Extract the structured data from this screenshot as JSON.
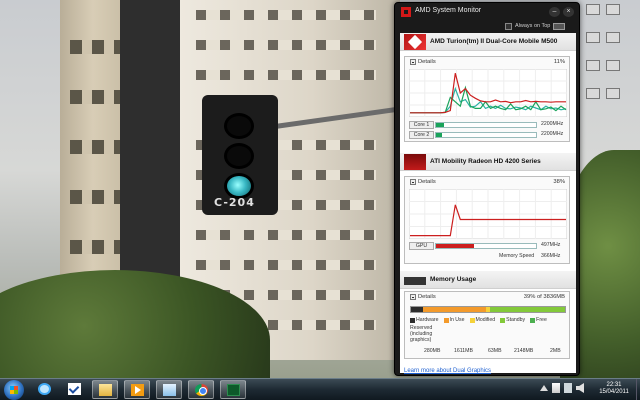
{
  "window": {
    "title": "AMD System Monitor",
    "always_on_top_label": "Always on Top",
    "minimize_glyph": "–",
    "close_glyph": "×"
  },
  "cpu": {
    "name": "AMD Turion(tm) II Dual-Core Mobile M500",
    "details_label": "Details",
    "usage_percent": "11%",
    "cores": [
      {
        "label": "Core 1",
        "load": 0.08,
        "value": "2200MHz"
      },
      {
        "label": "Core 2",
        "load": 0.06,
        "value": "2200MHz"
      }
    ],
    "history": {
      "red": [
        0.05,
        0.05,
        0.05,
        0.05,
        0.05,
        0.05,
        0.05,
        0.06,
        0.1,
        0.95,
        0.5,
        0.6,
        0.45,
        0.38,
        0.32,
        0.3,
        0.3,
        0.34,
        0.3,
        0.31,
        0.28,
        0.3,
        0.3,
        0.33,
        0.3,
        0.31,
        0.3,
        0.3,
        0.29,
        0.3,
        0.3,
        0.3
      ],
      "green": [
        0.05,
        0.05,
        0.05,
        0.05,
        0.05,
        0.05,
        0.05,
        0.06,
        0.4,
        0.3,
        0.2,
        0.62,
        0.2,
        0.15,
        0.15,
        0.3,
        0.15,
        0.2,
        0.15,
        0.12,
        0.25,
        0.12,
        0.14,
        0.2,
        0.12,
        0.3,
        0.12,
        0.14,
        0.18,
        0.1,
        0.2,
        0.12
      ],
      "teal": [
        0.05,
        0.05,
        0.05,
        0.05,
        0.05,
        0.05,
        0.05,
        0.06,
        0.2,
        0.6,
        0.3,
        0.35,
        0.18,
        0.2,
        0.3,
        0.15,
        0.2,
        0.15,
        0.22,
        0.15,
        0.14,
        0.18,
        0.16,
        0.12,
        0.2,
        0.16,
        0.12,
        0.2,
        0.14,
        0.16,
        0.12,
        0.14
      ]
    }
  },
  "gpu": {
    "name": "ATI Mobility Radeon HD 4200 Series",
    "details_label": "Details",
    "usage_percent": "38%",
    "bar_label": "GPU",
    "load": 0.38,
    "clock": "497MHz",
    "memory_speed_label": "Memory Speed",
    "memory_speed": "366MHz",
    "history": [
      0.03,
      0.03,
      0.03,
      0.03,
      0.03,
      0.03,
      0.03,
      0.03,
      0.03,
      0.7,
      0.38,
      0.38,
      0.38,
      0.38,
      0.38,
      0.38,
      0.38,
      0.38,
      0.38,
      0.38,
      0.38,
      0.38,
      0.38,
      0.38,
      0.38,
      0.38,
      0.38,
      0.38,
      0.38,
      0.38,
      0.38,
      0.38
    ]
  },
  "memory": {
    "title": "Memory Usage",
    "details_label": "Details",
    "usage_text": "39% of 3836MB",
    "segments": [
      {
        "name": "Hardware",
        "fraction": 0.08,
        "color": "#2d2d2d"
      },
      {
        "name": "In Use",
        "fraction": 0.42,
        "color": "#f39a2b"
      },
      {
        "name": "Modified",
        "fraction": 0.02,
        "color": "#f5d23a"
      },
      {
        "name": "Standby",
        "fraction": 0.5,
        "color": "#83c93a"
      },
      {
        "name": "Free",
        "fraction": 0.0,
        "color": "#4caf50"
      }
    ],
    "legend": [
      "Hardware",
      "In Use",
      "Modified",
      "Standby",
      "Free"
    ],
    "reserved_note": "Reserved (including graphics)",
    "values": [
      "280MB",
      "1611MB",
      "63MB",
      "2148MB",
      "2MB"
    ]
  },
  "footer_link": "Learn more about Dual Graphics",
  "taskbar": {
    "clock_time": "22:31",
    "clock_date": "15/04/2011",
    "buttons": [
      "ie-icon",
      "checkmark-icon",
      "folder-icon",
      "media-player-icon",
      "file-manager-icon",
      "chrome-icon",
      "amd-monitor-icon"
    ]
  },
  "wallpaper": {
    "traffic_light_label": "C-204"
  },
  "colors": {
    "accent_red": "#cc1f1f",
    "accent_green": "#1aa35a",
    "link_blue": "#1d5fd0"
  }
}
